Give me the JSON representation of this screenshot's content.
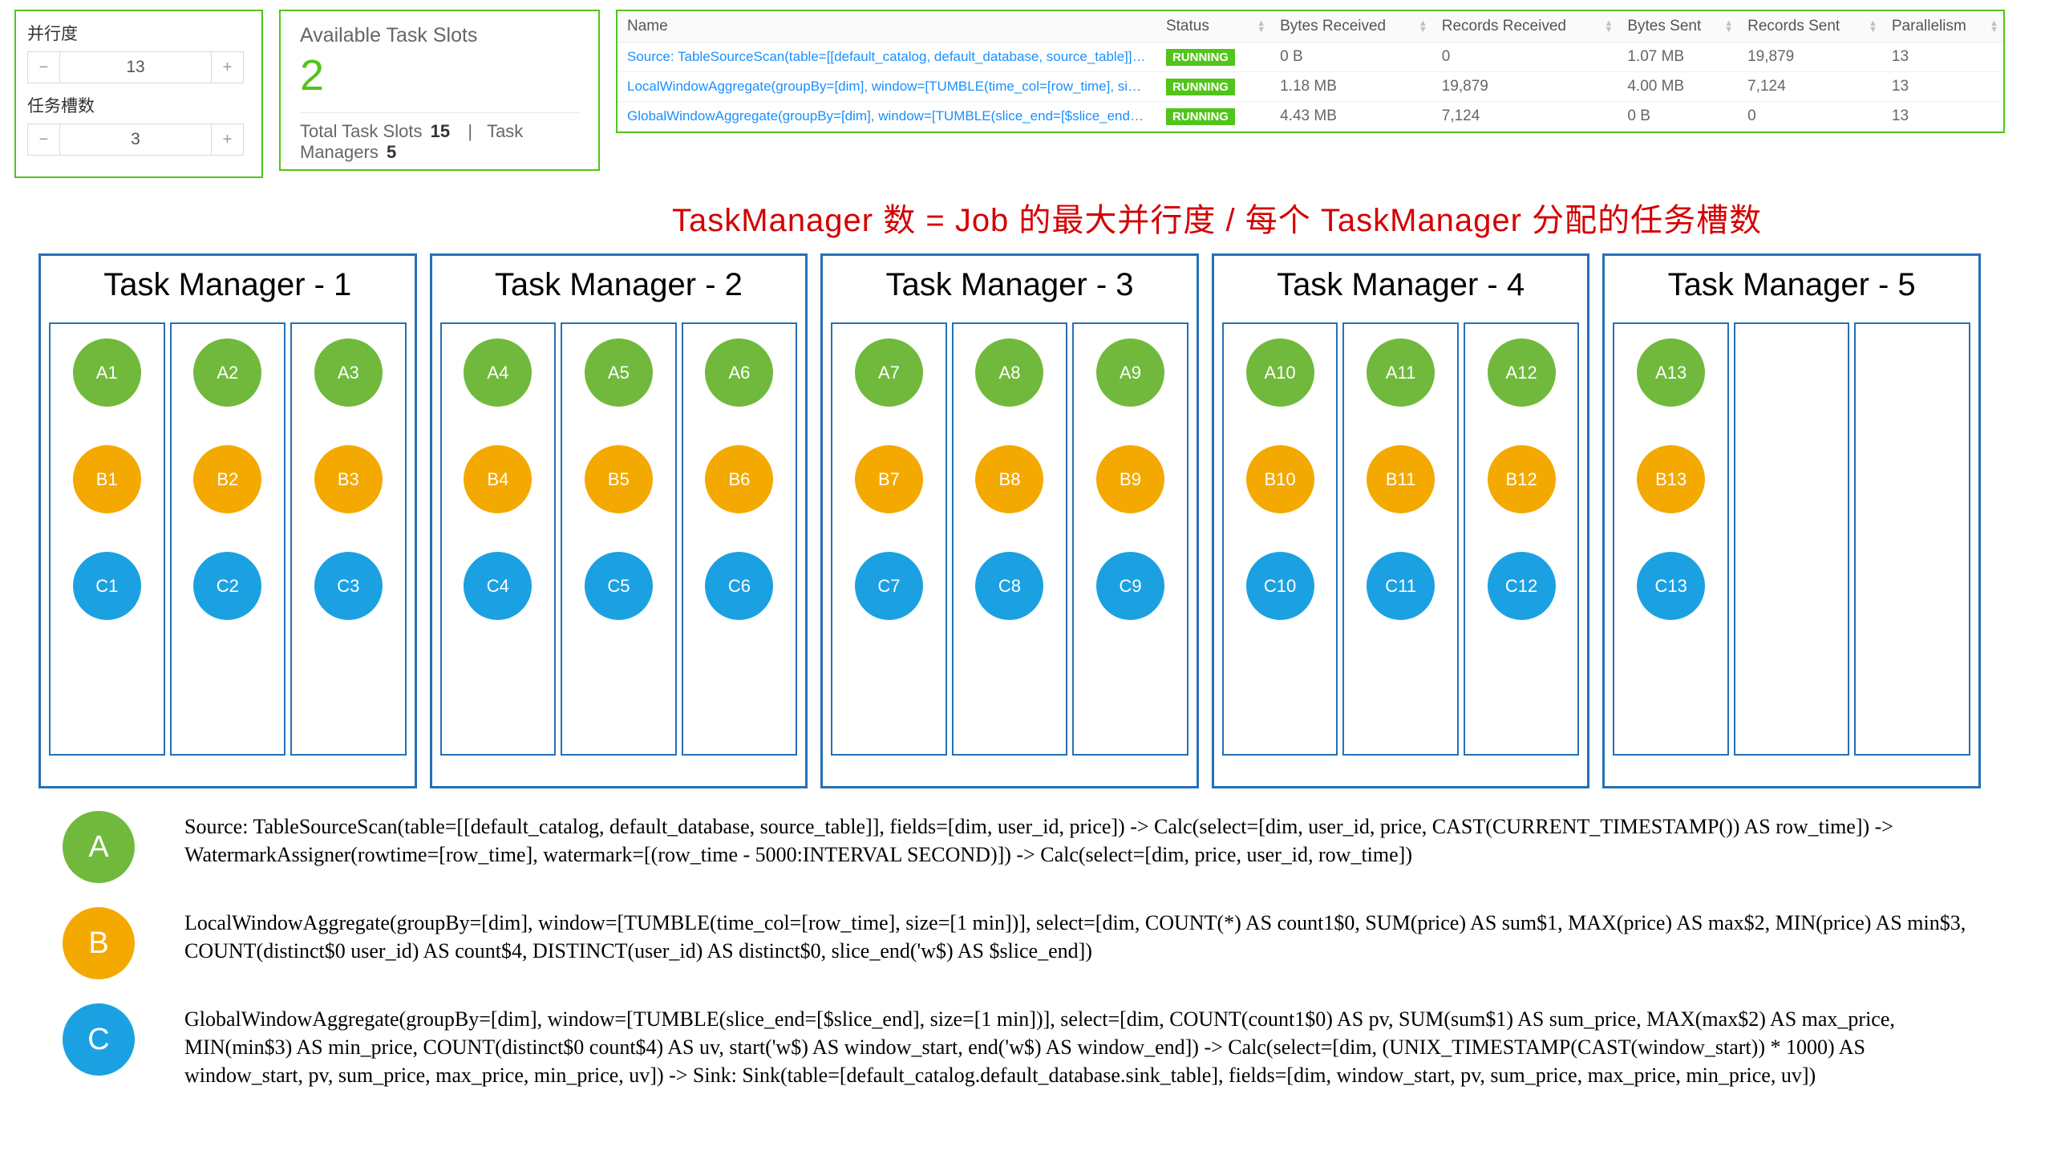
{
  "stepper": {
    "parallelism_label": "并行度",
    "parallelism_value": "13",
    "slots_label": "任务槽数",
    "slots_value": "3",
    "minus": "−",
    "plus": "+"
  },
  "slots_panel": {
    "title": "Available Task Slots",
    "value": "2",
    "total_label": "Total Task Slots",
    "total_value": "15",
    "tm_label": "Task Managers",
    "tm_value": "5"
  },
  "job_table": {
    "headers": [
      "Name",
      "Status",
      "Bytes Received",
      "Records Received",
      "Bytes Sent",
      "Records Sent",
      "Parallelism"
    ],
    "rows": [
      {
        "name": "Source: TableSourceScan(table=[[default_catalog, default_database, source_table]], fields=[...",
        "status": "RUNNING",
        "br": "0 B",
        "rr": "0",
        "bs": "1.07 MB",
        "rs": "19,879",
        "p": "13"
      },
      {
        "name": "LocalWindowAggregate(groupBy=[dim], window=[TUMBLE(time_col=[row_time], size=[1 ...",
        "status": "RUNNING",
        "br": "1.18 MB",
        "rr": "19,879",
        "bs": "4.00 MB",
        "rs": "7,124",
        "p": "13"
      },
      {
        "name": "GlobalWindowAggregate(groupBy=[dim], window=[TUMBLE(slice_end=[$slice_end], size=[...",
        "status": "RUNNING",
        "br": "4.43 MB",
        "rr": "7,124",
        "bs": "0 B",
        "rs": "0",
        "p": "13"
      }
    ]
  },
  "formula": "TaskManager 数 = Job 的最大并行度 / 每个 TaskManager 分配的任务槽数",
  "task_managers": [
    {
      "title": "Task Manager - 1",
      "slots": [
        [
          "A1",
          "B1",
          "C1"
        ],
        [
          "A2",
          "B2",
          "C2"
        ],
        [
          "A3",
          "B3",
          "C3"
        ]
      ]
    },
    {
      "title": "Task Manager - 2",
      "slots": [
        [
          "A4",
          "B4",
          "C4"
        ],
        [
          "A5",
          "B5",
          "C5"
        ],
        [
          "A6",
          "B6",
          "C6"
        ]
      ]
    },
    {
      "title": "Task Manager - 3",
      "slots": [
        [
          "A7",
          "B7",
          "C7"
        ],
        [
          "A8",
          "B8",
          "C8"
        ],
        [
          "A9",
          "B9",
          "C9"
        ]
      ]
    },
    {
      "title": "Task Manager - 4",
      "slots": [
        [
          "A10",
          "B10",
          "C10"
        ],
        [
          "A11",
          "B11",
          "C11"
        ],
        [
          "A12",
          "B12",
          "C12"
        ]
      ]
    },
    {
      "title": "Task Manager - 5",
      "slots": [
        [
          "A13",
          "B13",
          "C13"
        ],
        [],
        []
      ]
    }
  ],
  "legend": {
    "A": {
      "letter": "A",
      "text": "Source: TableSourceScan(table=[[default_catalog, default_database, source_table]], fields=[dim, user_id, price]) -> Calc(select=[dim, user_id, price, CAST(CURRENT_TIMESTAMP()) AS row_time]) -> WatermarkAssigner(rowtime=[row_time], watermark=[(row_time - 5000:INTERVAL SECOND)]) -> Calc(select=[dim, price, user_id, row_time])"
    },
    "B": {
      "letter": "B",
      "text": "LocalWindowAggregate(groupBy=[dim], window=[TUMBLE(time_col=[row_time], size=[1 min])], select=[dim, COUNT(*) AS count1$0, SUM(price) AS sum$1, MAX(price) AS max$2, MIN(price) AS min$3, COUNT(distinct$0 user_id) AS count$4, DISTINCT(user_id) AS distinct$0, slice_end('w$) AS $slice_end])"
    },
    "C": {
      "letter": "C",
      "text": "GlobalWindowAggregate(groupBy=[dim], window=[TUMBLE(slice_end=[$slice_end], size=[1 min])], select=[dim, COUNT(count1$0) AS pv, SUM(sum$1) AS sum_price, MAX(max$2) AS max_price, MIN(min$3) AS min_price, COUNT(distinct$0 count$4) AS uv, start('w$) AS window_start, end('w$) AS window_end]) -> Calc(select=[dim, (UNIX_TIMESTAMP(CAST(window_start)) * 1000) AS window_start, pv, sum_price, max_price, min_price, uv]) -> Sink: Sink(table=[default_catalog.default_database.sink_table], fields=[dim, window_start, pv, sum_price, max_price, min_price, uv])"
    }
  }
}
